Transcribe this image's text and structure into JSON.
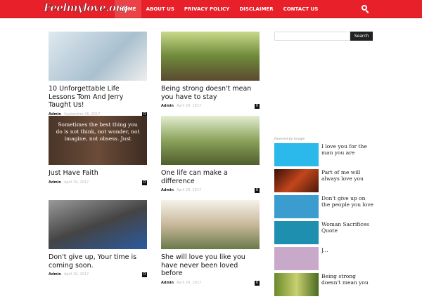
{
  "header": {
    "logo": "Feelmylove.org",
    "nav": [
      "HOME",
      "ABOUT US",
      "PRIVACY POLICY",
      "DISCLAIMER",
      "CONTACT US"
    ]
  },
  "posts": [
    {
      "title": "10 Unforgettable Life Lessons Tom And Jerry Taught Us!",
      "author": "Admin",
      "date": "September 26, 2017",
      "comments": "0"
    },
    {
      "title": "Being strong doesn't mean you have to stay",
      "author": "Admin",
      "date": "April 29, 2017",
      "comments": "0"
    },
    {
      "title": "Just Have Faith",
      "author": "Admin",
      "date": "April 29, 2017",
      "comments": "0",
      "image_text": "Sometimes the best thing you do is not think, not wonder, not imagine, not obsess. Just"
    },
    {
      "title": "One life can make a difference",
      "author": "Admin",
      "date": "April 29, 2017",
      "comments": "0"
    },
    {
      "title": "Don't give up, Your time is coming soon.",
      "author": "Admin",
      "date": "April 29, 2017",
      "comments": "0"
    },
    {
      "title": "She will love you like you have never been loved before",
      "author": "Admin",
      "date": "April 29, 2017",
      "comments": "0"
    }
  ],
  "sidebar": {
    "search_button": "Search",
    "powered": "Powered by Google",
    "ads": [
      "I love you for the man you are",
      "Part of me will always love you",
      "Don't give up on the people you love",
      "Woman Sacrifices Quote",
      "J...",
      "Being strong doesn't mean you"
    ]
  }
}
